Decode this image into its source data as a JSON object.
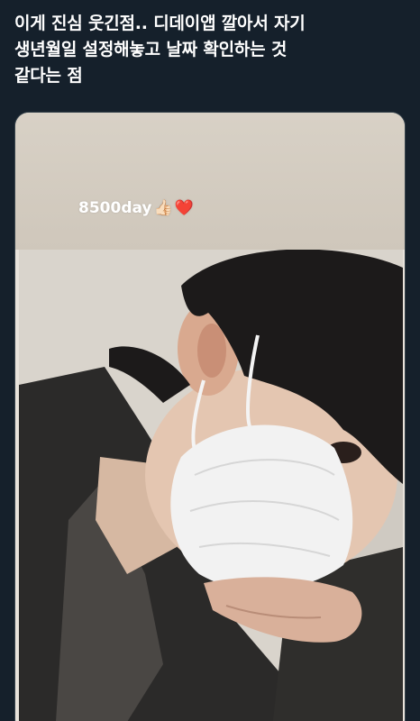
{
  "tweet": {
    "text": "이게 진심 웃긴점.. 디데이앱 깔아서 자기\n생년월일 설정해놓고 날짜 확인하는 것\n같다는 점"
  },
  "media": {
    "caption": "8500day",
    "emojis": {
      "thumb": "👍🏻",
      "heart": "❤️"
    },
    "alt": "selfie-photo"
  },
  "colors": {
    "background": "#15202b",
    "text": "#ffffff",
    "heart": "#e0245e"
  }
}
